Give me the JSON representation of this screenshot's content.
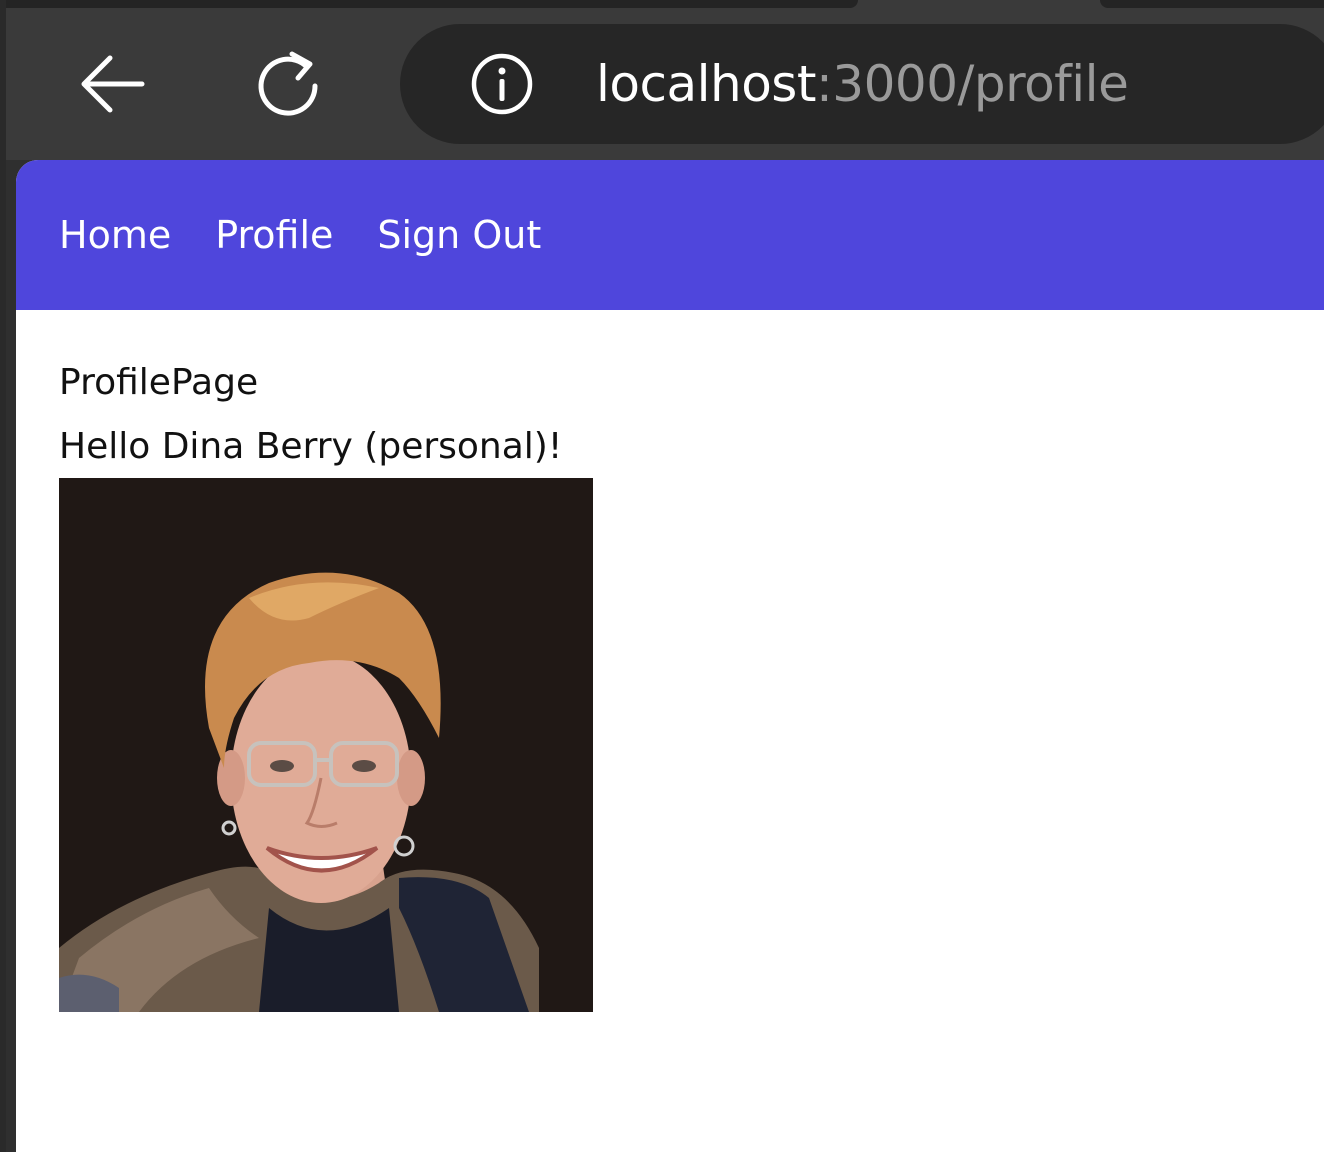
{
  "browser": {
    "url_host": "localhost",
    "url_path": ":3000/profile",
    "icons": {
      "back": "arrow-left-icon",
      "reload": "reload-icon",
      "site_info": "info-icon"
    }
  },
  "nav": {
    "links": [
      {
        "label": "Home"
      },
      {
        "label": "Profile"
      },
      {
        "label": "Sign Out"
      }
    ],
    "background_color": "#4f46dc"
  },
  "page": {
    "title": "ProfilePage",
    "greeting": "Hello Dina Berry (personal)!",
    "avatar": {
      "kind": "profile-photo"
    }
  }
}
